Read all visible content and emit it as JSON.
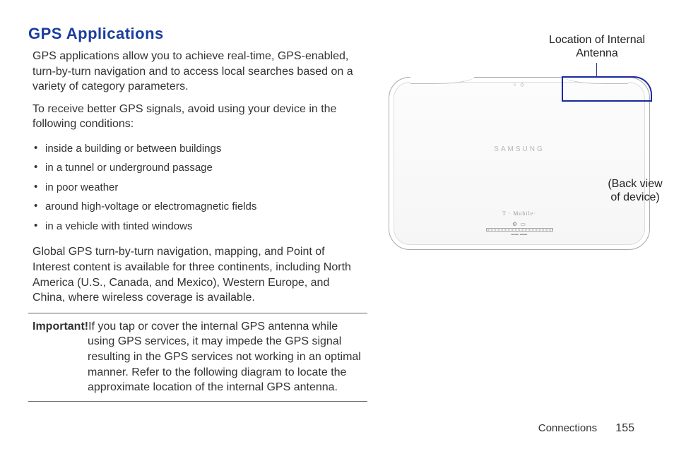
{
  "section_title": "GPS Applications",
  "para1": "GPS applications allow you to achieve real-time, GPS-enabled, turn-by-turn navigation and to access local searches based on a variety of category parameters.",
  "para2": "To receive better GPS signals, avoid using your device in the following conditions:",
  "bullets": [
    "inside a building or between buildings",
    "in a tunnel or underground passage",
    "in poor weather",
    "around high-voltage or electromagnetic fields",
    "in a vehicle with tinted windows"
  ],
  "para3": "Global GPS turn-by-turn navigation, mapping, and Point of Interest content is available for three continents, including North America (U.S., Canada, and Mexico), Western Europe, and China, where wireless coverage is available.",
  "important": {
    "label": "Important!",
    "body": "If you tap or cover the internal GPS antenna while using GPS services, it may impede the GPS signal resulting in the GPS services not working in an optimal manner. Refer to the following diagram to locate the approximate location of the internal GPS antenna."
  },
  "diagram": {
    "antenna_label_line1": "Location of Internal",
    "antenna_label_line2": "Antenna",
    "brand": "SAMSUNG",
    "carrier": "T · Mobile·",
    "back_view_line1": "(Back view",
    "back_view_line2": "of device)"
  },
  "footer": {
    "section": "Connections",
    "page": "155"
  }
}
